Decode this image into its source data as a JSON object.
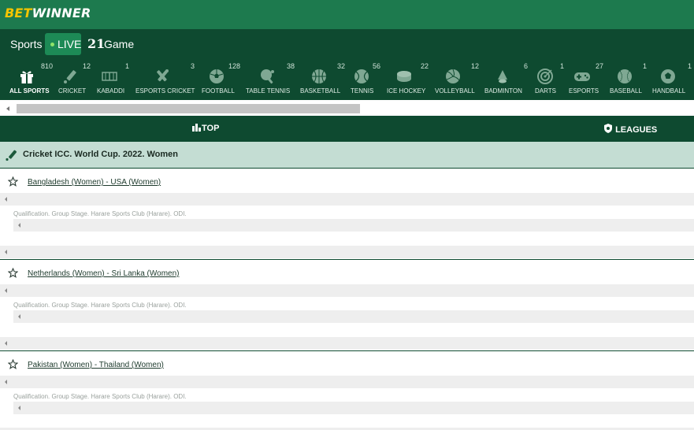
{
  "header": {
    "logo_bet": "BET",
    "logo_winner": "WINNER"
  },
  "nav": {
    "sports": "Sports",
    "live": "LIVE",
    "twentyone": "21",
    "game": "Game"
  },
  "sports": [
    {
      "label": "ALL SPORTS",
      "count": "810",
      "icon": "gift-icon"
    },
    {
      "label": "CRICKET",
      "count": "12",
      "icon": "cricket-bat-icon"
    },
    {
      "label": "KABADDI",
      "count": "1",
      "icon": "kabaddi-icon"
    },
    {
      "label": "ESPORTS CRICKET",
      "count": "3",
      "icon": "esports-cricket-icon"
    },
    {
      "label": "FOOTBALL",
      "count": "128",
      "icon": "football-icon"
    },
    {
      "label": "TABLE TENNIS",
      "count": "38",
      "icon": "table-tennis-icon"
    },
    {
      "label": "BASKETBALL",
      "count": "32",
      "icon": "basketball-icon"
    },
    {
      "label": "TENNIS",
      "count": "56",
      "icon": "tennis-ball-icon"
    },
    {
      "label": "ICE HOCKEY",
      "count": "22",
      "icon": "hockey-puck-icon"
    },
    {
      "label": "VOLLEYBALL",
      "count": "12",
      "icon": "volleyball-icon"
    },
    {
      "label": "BADMINTON",
      "count": "6",
      "icon": "shuttlecock-icon"
    },
    {
      "label": "DARTS",
      "count": "1",
      "icon": "dartboard-icon"
    },
    {
      "label": "ESPORTS",
      "count": "27",
      "icon": "gamepad-icon"
    },
    {
      "label": "BASEBALL",
      "count": "1",
      "icon": "baseball-icon"
    },
    {
      "label": "HANDBALL",
      "count": "1",
      "icon": "handball-icon"
    }
  ],
  "tabs": {
    "top": "TOP",
    "leagues": "LEAGUES"
  },
  "league": {
    "title": "Cricket ICC. World Cup. 2022. Women"
  },
  "matches": [
    {
      "teams": "Bangladesh (Women) - USA (Women)",
      "info": "Qualification. Group Stage. Harare Sports Club (Harare). ODI."
    },
    {
      "teams": "Netherlands (Women) - Sri Lanka (Women)",
      "info": "Qualification. Group Stage. Harare Sports Club (Harare). ODI."
    },
    {
      "teams": "Pakistan (Women) - Thailand (Women)",
      "info": "Qualification. Group Stage. Harare Sports Club (Harare). ODI."
    }
  ],
  "colors": {
    "header_green": "#1d7a4e",
    "dark_green": "#0e4a30",
    "live_green": "#1d8a56",
    "league_bg": "#c4ddd3",
    "logo_yellow": "#f5c400"
  }
}
